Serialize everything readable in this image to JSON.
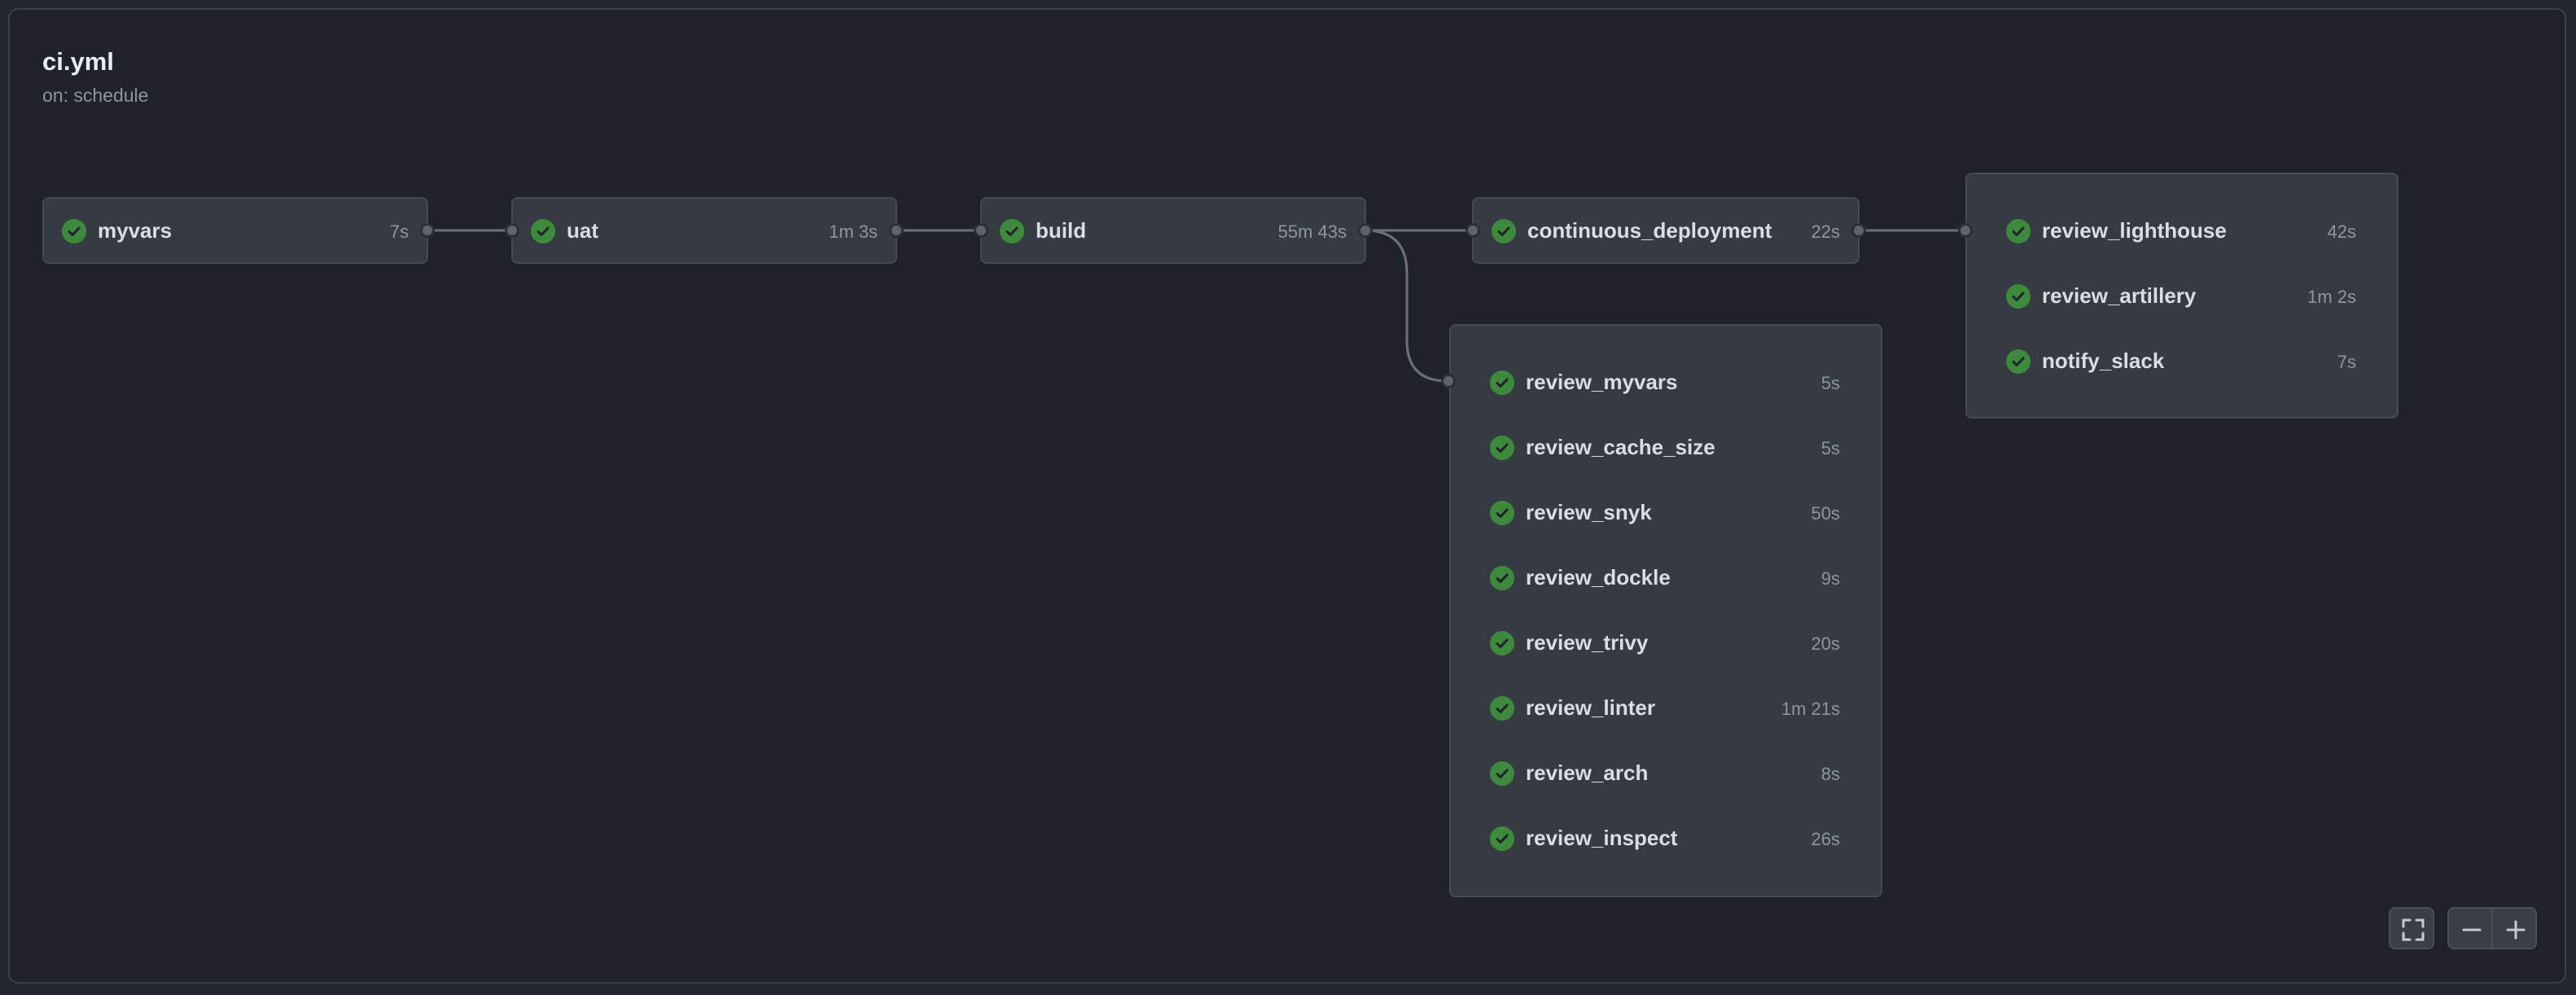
{
  "workflow": {
    "title": "ci.yml",
    "trigger": "on: schedule"
  },
  "status_color": "#3e8a3c",
  "jobs": {
    "myvars": {
      "name": "myvars",
      "duration": "7s",
      "status": "success"
    },
    "uat": {
      "name": "uat",
      "duration": "1m 3s",
      "status": "success"
    },
    "build": {
      "name": "build",
      "duration": "55m 43s",
      "status": "success"
    },
    "continuous_deployment": {
      "name": "continuous_deployment",
      "duration": "22s",
      "status": "success"
    }
  },
  "review_group": [
    {
      "name": "review_myvars",
      "duration": "5s",
      "status": "success"
    },
    {
      "name": "review_cache_size",
      "duration": "5s",
      "status": "success"
    },
    {
      "name": "review_snyk",
      "duration": "50s",
      "status": "success"
    },
    {
      "name": "review_dockle",
      "duration": "9s",
      "status": "success"
    },
    {
      "name": "review_trivy",
      "duration": "20s",
      "status": "success"
    },
    {
      "name": "review_linter",
      "duration": "1m 21s",
      "status": "success"
    },
    {
      "name": "review_arch",
      "duration": "8s",
      "status": "success"
    },
    {
      "name": "review_inspect",
      "duration": "26s",
      "status": "success"
    }
  ],
  "post_deploy_group": [
    {
      "name": "review_lighthouse",
      "duration": "42s",
      "status": "success"
    },
    {
      "name": "review_artillery",
      "duration": "1m 2s",
      "status": "success"
    },
    {
      "name": "notify_slack",
      "duration": "7s",
      "status": "success"
    }
  ],
  "controls": {
    "fullscreen_icon": "fullscreen-icon",
    "zoom_out_icon": "zoom-out-icon",
    "zoom_in_icon": "zoom-in-icon"
  }
}
